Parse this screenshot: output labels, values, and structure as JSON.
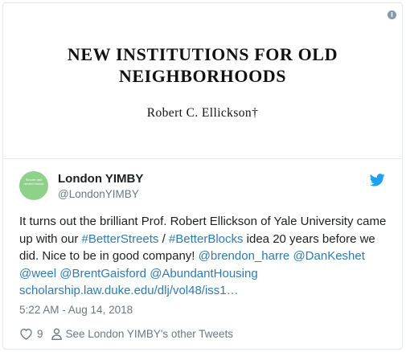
{
  "media": {
    "title_line1": "NEW INSTITUTIONS FOR OLD",
    "title_line2": "NEIGHBORHOODS",
    "author": "Robert C. Ellickson†"
  },
  "user": {
    "name": "London YIMBY",
    "handle": "@LondonYIMBY",
    "avatar_text": "Secure and decent homes"
  },
  "tweet": {
    "text_intro": "It turns out the brilliant Prof. Robert Ellickson of Yale University came up with our ",
    "hashtag_1": "#BetterStreets",
    "slash": " / ",
    "hashtag_2": "#BetterBlocks",
    "text_mid": " idea 20 years before we did. Nice to be in good company! ",
    "mention_1": "@brendon_harre",
    "mention_2": "@DanKeshet",
    "mention_3": "@weel",
    "mention_4": "@BrentGaisford",
    "mention_5": "@AbundantHousing",
    "url": "scholarship.law.duke.edu/dlj/vol48/iss1…",
    "space": " "
  },
  "timestamp": "5:22 AM - Aug 14, 2018",
  "actions": {
    "like_count": "9",
    "others_label": "See London YIMBY's other Tweets"
  },
  "colors": {
    "link": "#2b7bb9",
    "twitter_blue": "#1da1f2",
    "muted": "#697882",
    "avatar_green": "#8ed28a"
  },
  "icons": [
    "info-icon",
    "twitter-bird-icon",
    "heart-icon",
    "person-icon"
  ]
}
